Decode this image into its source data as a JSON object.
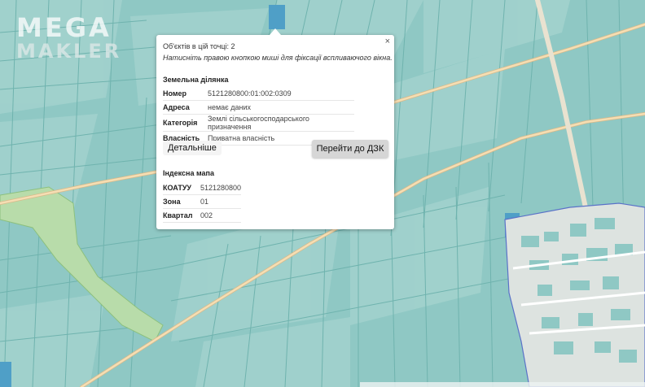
{
  "watermark": {
    "line1": "MEGA",
    "line2": "MAKLER"
  },
  "popup": {
    "close_label": "×",
    "objects_count": "Об'єктів в цій точці: 2",
    "hint": "Натисніть правою кнопкою миші для фіксації вспливаючого вікна.",
    "land_title": "Земельна ділянка",
    "land_rows": [
      {
        "key": "Номер",
        "value": "5121280800:01:002:0309"
      },
      {
        "key": "Адреса",
        "value": "немає даних"
      },
      {
        "key": "Категорія",
        "value": "Землі сільськогосподарського призначення"
      },
      {
        "key": "Власність",
        "value": "Приватна власність"
      }
    ],
    "details_button": "Детальніше",
    "dzk_button": "Перейти до ДЗК",
    "index_title": "Індексна мапа",
    "index_rows": [
      {
        "key": "КОАТУУ",
        "value": "5121280800"
      },
      {
        "key": "Зона",
        "value": "01"
      },
      {
        "key": "Квартал",
        "value": "002"
      }
    ]
  },
  "colors": {
    "parcel": "#8fc8c4",
    "parcel_line": "#5aa8a4",
    "road": "#f5deb3",
    "popup_bg": "#ffffff"
  }
}
